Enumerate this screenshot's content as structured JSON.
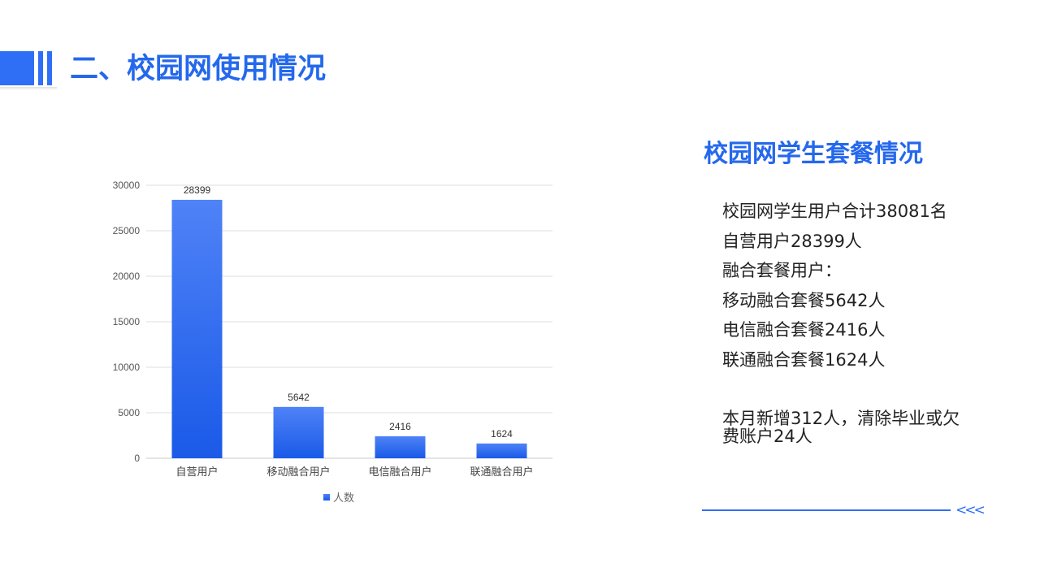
{
  "header": {
    "title": "二、校园网使用情况"
  },
  "chart_data": {
    "type": "bar",
    "categories": [
      "自营用户",
      "移动融合用户",
      "电信融合用户",
      "联通融合用户"
    ],
    "series": [
      {
        "name": "人数",
        "values": [
          28399,
          5642,
          2416,
          1624
        ]
      }
    ],
    "ylim": [
      0,
      30000
    ],
    "yticks": [
      0,
      5000,
      10000,
      15000,
      20000,
      25000,
      30000
    ],
    "data_labels": true,
    "grid": true,
    "legend_position": "bottom",
    "bar_color": "#2a6cf2"
  },
  "side_panel": {
    "title": "校园网学生套餐情况",
    "lines": [
      "校园网学生用户合计38081名",
      "自营用户28399人",
      "融合套餐用户：",
      "移动融合套餐5642人",
      "电信融合套餐2416人",
      "联通融合套餐1624人"
    ],
    "note": "本月新增312人，清除毕业或欠费账户24人"
  },
  "decor": {
    "accent_color": "#2f6ff5",
    "chevron": "<<<"
  }
}
